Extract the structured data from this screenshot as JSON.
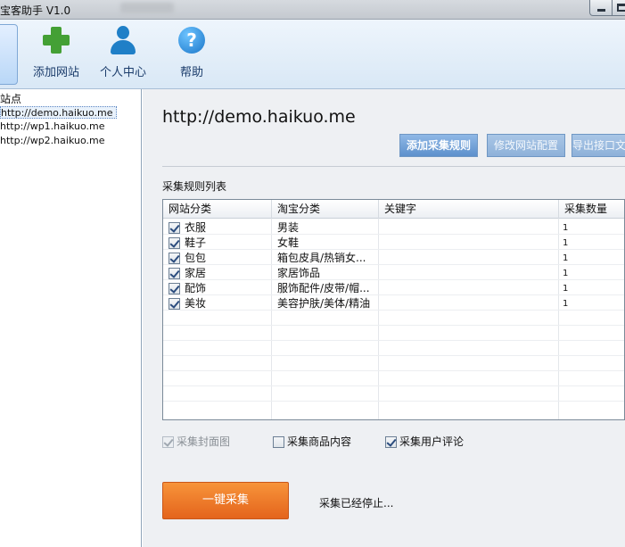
{
  "window": {
    "title": "宝客助手 V1.0"
  },
  "toolbar": {
    "items": [
      {
        "label": "添加网站",
        "icon": "plus-icon"
      },
      {
        "label": "个人中心",
        "icon": "user-icon"
      },
      {
        "label": "帮助",
        "icon": "help-icon"
      }
    ]
  },
  "sidebar": {
    "root_label": "站点",
    "sites": [
      {
        "label": "http://demo.haikuo.me",
        "selected": true
      },
      {
        "label": "http://wp1.haikuo.me",
        "selected": false
      },
      {
        "label": "http://wp2.haikuo.me",
        "selected": false
      }
    ]
  },
  "main": {
    "site_url": "http://demo.haikuo.me",
    "buttons": {
      "add_rule": "添加采集规则",
      "edit_site": "修改网站配置",
      "export": "导出接口文件"
    },
    "list_title": "采集规则列表",
    "grid": {
      "columns": [
        "网站分类",
        "淘宝分类",
        "关键字",
        "采集数量"
      ],
      "rows": [
        {
          "checked": true,
          "category": "衣服",
          "taobao_category": "男装",
          "keyword": "",
          "count": "1"
        },
        {
          "checked": true,
          "category": "鞋子",
          "taobao_category": "女鞋",
          "keyword": "",
          "count": "1"
        },
        {
          "checked": true,
          "category": "包包",
          "taobao_category": "箱包皮具/热销女...",
          "keyword": "",
          "count": "1"
        },
        {
          "checked": true,
          "category": "家居",
          "taobao_category": "家居饰品",
          "keyword": "",
          "count": "1"
        },
        {
          "checked": true,
          "category": "配饰",
          "taobao_category": "服饰配件/皮带/帽...",
          "keyword": "",
          "count": "1"
        },
        {
          "checked": true,
          "category": "美妆",
          "taobao_category": "美容护肤/美体/精油",
          "keyword": "",
          "count": "1"
        }
      ]
    },
    "options": [
      {
        "label": "采集封面图",
        "checked": true,
        "disabled": true
      },
      {
        "label": "采集商品内容",
        "checked": false,
        "disabled": false
      },
      {
        "label": "采集用户评论",
        "checked": true,
        "disabled": false
      }
    ],
    "collect_button": "一键采集",
    "status_text": "采集已经停止..."
  },
  "colors": {
    "accent_orange": "#e4641c",
    "button_blue": "#5d90cc",
    "check_green": "#44a035"
  }
}
